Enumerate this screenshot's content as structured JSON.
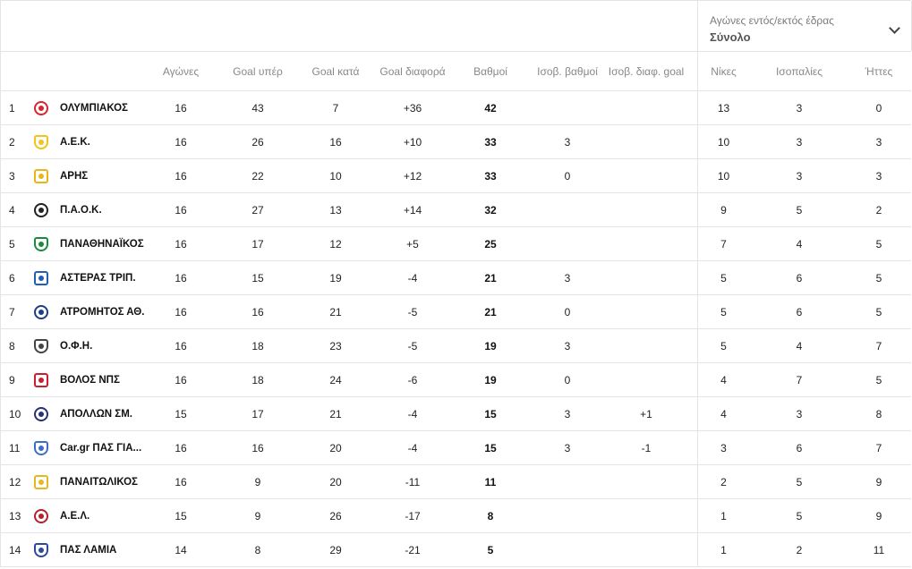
{
  "filter": {
    "label": "Αγώνες εντός/εκτός έδρας",
    "value": "Σύνολο"
  },
  "headers": {
    "played": "Αγώνες",
    "gf": "Goal υπέρ",
    "ga": "Goal κατά",
    "gd": "Goal διαφορά",
    "pts": "Βαθμοί",
    "hpts": "Ισοβ. βαθμοί",
    "hgd": "Ισοβ. διαφ. goal",
    "wins": "Νίκες",
    "draws": "Ισοπαλίες",
    "losses": "Ήττες"
  },
  "rows": [
    {
      "pos": "1",
      "team": "ΟΛΥΜΠΙΑΚΟΣ",
      "played": "16",
      "gf": "43",
      "ga": "7",
      "gd": "+36",
      "pts": "42",
      "hpts": "",
      "hgd": "",
      "wins": "13",
      "draws": "3",
      "losses": "0",
      "crest_color": "#d7242d",
      "crest_icon": "olympiakos-crest-icon"
    },
    {
      "pos": "2",
      "team": "Α.Ε.Κ.",
      "played": "16",
      "gf": "26",
      "ga": "16",
      "gd": "+10",
      "pts": "33",
      "hpts": "3",
      "hgd": "",
      "wins": "10",
      "draws": "3",
      "losses": "3",
      "crest_color": "#f2c318",
      "crest_icon": "aek-crest-icon"
    },
    {
      "pos": "3",
      "team": "ΑΡΗΣ",
      "played": "16",
      "gf": "22",
      "ga": "10",
      "gd": "+12",
      "pts": "33",
      "hpts": "0",
      "hgd": "",
      "wins": "10",
      "draws": "3",
      "losses": "3",
      "crest_color": "#e9b618",
      "crest_icon": "aris-crest-icon"
    },
    {
      "pos": "4",
      "team": "Π.Α.Ο.Κ.",
      "played": "16",
      "gf": "27",
      "ga": "13",
      "gd": "+14",
      "pts": "32",
      "hpts": "",
      "hgd": "",
      "wins": "9",
      "draws": "5",
      "losses": "2",
      "crest_color": "#222222",
      "crest_icon": "paok-crest-icon"
    },
    {
      "pos": "5",
      "team": "ΠΑΝΑΘΗΝΑΪΚΟΣ",
      "played": "16",
      "gf": "17",
      "ga": "12",
      "gd": "+5",
      "pts": "25",
      "hpts": "",
      "hgd": "",
      "wins": "7",
      "draws": "4",
      "losses": "5",
      "crest_color": "#1c8a3d",
      "crest_icon": "panathinaikos-crest-icon"
    },
    {
      "pos": "6",
      "team": "ΑΣΤΕΡΑΣ ΤΡΙΠ.",
      "played": "16",
      "gf": "15",
      "ga": "19",
      "gd": "-4",
      "pts": "21",
      "hpts": "3",
      "hgd": "",
      "wins": "5",
      "draws": "6",
      "losses": "5",
      "crest_color": "#1f5fb4",
      "crest_icon": "asteras-crest-icon"
    },
    {
      "pos": "7",
      "team": "ΑΤΡΟΜΗΤΟΣ ΑΘ.",
      "played": "16",
      "gf": "16",
      "ga": "21",
      "gd": "-5",
      "pts": "21",
      "hpts": "0",
      "hgd": "",
      "wins": "5",
      "draws": "6",
      "losses": "5",
      "crest_color": "#1d3d8a",
      "crest_icon": "atromitos-crest-icon"
    },
    {
      "pos": "8",
      "team": "Ο.Φ.Η.",
      "played": "16",
      "gf": "18",
      "ga": "23",
      "gd": "-5",
      "pts": "19",
      "hpts": "3",
      "hgd": "",
      "wins": "5",
      "draws": "4",
      "losses": "7",
      "crest_color": "#444444",
      "crest_icon": "ofi-crest-icon"
    },
    {
      "pos": "9",
      "team": "ΒΟΛΟΣ ΝΠΣ",
      "played": "16",
      "gf": "18",
      "ga": "24",
      "gd": "-6",
      "pts": "19",
      "hpts": "0",
      "hgd": "",
      "wins": "4",
      "draws": "7",
      "losses": "5",
      "crest_color": "#c8202f",
      "crest_icon": "volos-crest-icon"
    },
    {
      "pos": "10",
      "team": "ΑΠΟΛΛΩΝ ΣΜ.",
      "played": "15",
      "gf": "17",
      "ga": "21",
      "gd": "-4",
      "pts": "15",
      "hpts": "3",
      "hgd": "+1",
      "wins": "4",
      "draws": "3",
      "losses": "8",
      "crest_color": "#27307a",
      "crest_icon": "apollon-crest-icon"
    },
    {
      "pos": "11",
      "team": "Car.gr ΠΑΣ ΓΙΑ...",
      "played": "16",
      "gf": "16",
      "ga": "20",
      "gd": "-4",
      "pts": "15",
      "hpts": "3",
      "hgd": "-1",
      "wins": "3",
      "draws": "6",
      "losses": "7",
      "crest_color": "#3c6fc4",
      "crest_icon": "pas-giannina-crest-icon"
    },
    {
      "pos": "12",
      "team": "ΠΑΝΑΙΤΩΛΙΚΟΣ",
      "played": "16",
      "gf": "9",
      "ga": "20",
      "gd": "-11",
      "pts": "11",
      "hpts": "",
      "hgd": "",
      "wins": "2",
      "draws": "5",
      "losses": "9",
      "crest_color": "#e4b823",
      "crest_icon": "panetolikos-crest-icon"
    },
    {
      "pos": "13",
      "team": "Α.Ε.Λ.",
      "played": "15",
      "gf": "9",
      "ga": "26",
      "gd": "-17",
      "pts": "8",
      "hpts": "",
      "hgd": "",
      "wins": "1",
      "draws": "5",
      "losses": "9",
      "crest_color": "#b5202a",
      "crest_icon": "ael-crest-icon"
    },
    {
      "pos": "14",
      "team": "ΠΑΣ ΛΑΜΙΑ",
      "played": "14",
      "gf": "8",
      "ga": "29",
      "gd": "-21",
      "pts": "5",
      "hpts": "",
      "hgd": "",
      "wins": "1",
      "draws": "2",
      "losses": "11",
      "crest_color": "#2a4a9a",
      "crest_icon": "lamia-crest-icon"
    }
  ]
}
